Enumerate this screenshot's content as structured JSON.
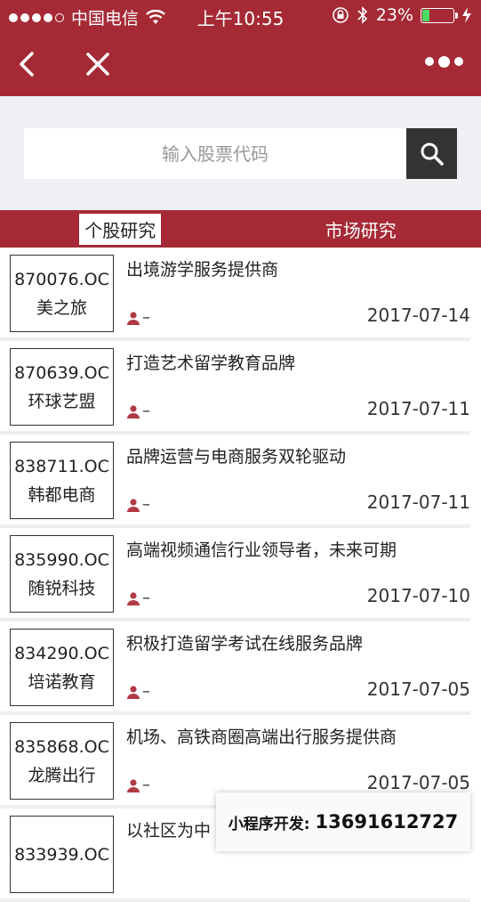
{
  "status_bar": {
    "carrier": "中国电信",
    "time": "上午10:55",
    "battery": "23%",
    "battery_level": 0.23
  },
  "search": {
    "placeholder": "输入股票代码"
  },
  "tabs": [
    {
      "label": "个股研究",
      "active": true
    },
    {
      "label": "市场研究",
      "active": false
    }
  ],
  "reports": [
    {
      "code": "870076.OC",
      "name": "美之旅",
      "title": "出境游学服务提供商",
      "author": "–",
      "date": "2017-07-14"
    },
    {
      "code": "870639.OC",
      "name": "环球艺盟",
      "title": "打造艺术留学教育品牌",
      "author": "–",
      "date": "2017-07-11"
    },
    {
      "code": "838711.OC",
      "name": "韩都电商",
      "title": "品牌运营与电商服务双轮驱动",
      "author": "–",
      "date": "2017-07-11"
    },
    {
      "code": "835990.OC",
      "name": "随锐科技",
      "title": "高端视频通信行业领导者，未来可期",
      "author": "–",
      "date": "2017-07-10"
    },
    {
      "code": "834290.OC",
      "name": "培诺教育",
      "title": "积极打造留学考试在线服务品牌",
      "author": "–",
      "date": "2017-07-05"
    },
    {
      "code": "835868.OC",
      "name": "龙腾出行",
      "title": "机场、高铁商圈高端出行服务提供商",
      "author": "–",
      "date": "2017-07-05"
    },
    {
      "code": "833939.OC",
      "name": "",
      "title": "以社区为中",
      "author": "",
      "date": ""
    }
  ],
  "promo": {
    "label": "小程序开发:",
    "phone": "13691612727"
  },
  "colors": {
    "brand": "#a52a35",
    "search_button": "#333333",
    "battery_fill": "#4cd964"
  }
}
